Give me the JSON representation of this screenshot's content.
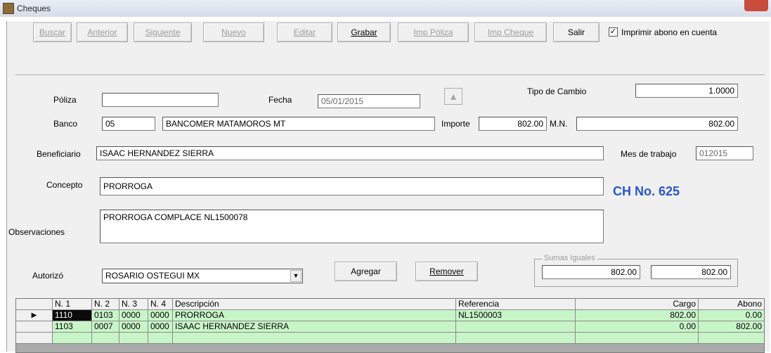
{
  "window": {
    "title": "Cheques"
  },
  "toolbar": {
    "buttons": [
      {
        "label": "Buscar"
      },
      {
        "label": "Anterior"
      },
      {
        "label": "Siguiente"
      },
      {
        "label": "Nuevo"
      },
      {
        "label": "Editar"
      },
      {
        "label": "Grabar"
      },
      {
        "label": "Imp Póliza"
      },
      {
        "label": "Imp Cheque"
      },
      {
        "label": "Salir"
      }
    ],
    "checkbox": {
      "label": "Imprimir abono en cuenta",
      "checked": "✓"
    }
  },
  "form": {
    "poliza_label": "Póliza",
    "poliza_value": "",
    "fecha_label": "Fecha",
    "fecha_value": "05/01/2015",
    "tipo_cambio_label": "Tipo de Cambio",
    "tipo_cambio_value": "1.0000",
    "banco_label": "Banco",
    "banco_code": "05",
    "banco_name": "BANCOMER MATAMOROS MT",
    "importe_label": "Importe",
    "importe_value": "802.00",
    "mn_label": "M.N.",
    "mn_value": "802.00",
    "beneficiario_label": "Beneficiario",
    "beneficiario_value": "ISAAC HERNANDEZ SIERRA",
    "mes_trabajo_label": "Mes de trabajo",
    "mes_trabajo_value": "012015",
    "concepto_label": "Concepto",
    "concepto_value": "PRORROGA",
    "observaciones_label": "Observaciones",
    "observaciones_value": "PRORROGA COMPLACE NL1500078",
    "ch_no": "CH No. 625",
    "autorizo_label": "Autorizó",
    "autorizo_value": "ROSARIO OSTEGUI MX",
    "agregar_label": "Agregar",
    "remover_label": "Remover",
    "sumas_label": "Sumas Iguales",
    "suma_cargo": "802.00",
    "suma_abono": "802.00"
  },
  "grid": {
    "columns": [
      "N. 1",
      "N. 2",
      "N. 3",
      "N. 4",
      "Descripción",
      "Referencia",
      "Cargo",
      "Abono"
    ],
    "rows": [
      {
        "n1": "1110",
        "n2": "0103",
        "n3": "0000",
        "n4": "0000",
        "desc": "PRORROGA",
        "ref": "NL1500003",
        "cargo": "802.00",
        "abono": "0.00"
      },
      {
        "n1": "1103",
        "n2": "0007",
        "n3": "0000",
        "n4": "0000",
        "desc": "ISAAC HERNANDEZ SIERRA",
        "ref": "",
        "cargo": "0.00",
        "abono": "802.00"
      }
    ]
  },
  "colors": {
    "accent_text": "#2a57c8",
    "grid_row_bg": "#c8f5c8",
    "title_close": "#c84b3c"
  }
}
